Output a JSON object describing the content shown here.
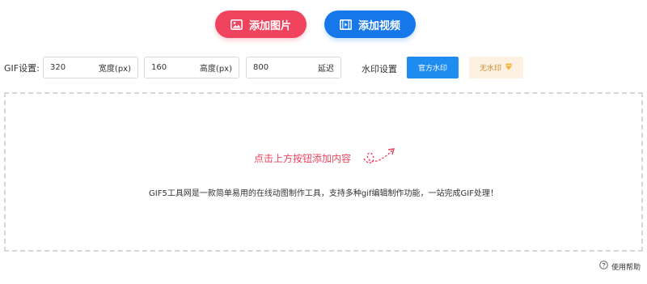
{
  "top_buttons": {
    "add_image": "添加图片",
    "add_video": "添加视频",
    "add_image_color": "#f0435d",
    "add_video_color": "#1677ea"
  },
  "settings": {
    "gif_label": "GIF设置:",
    "width": {
      "value": "320",
      "unit": "宽度(px)"
    },
    "height": {
      "value": "160",
      "unit": "高度(px)"
    },
    "delay": {
      "value": "800",
      "unit": "延迟"
    },
    "watermark_label": "水印设置",
    "watermark_official": "官方水印",
    "watermark_none": "无水印"
  },
  "drop_area": {
    "hint": "点击上方按钮添加内容",
    "description": "GIF5工具网是一款简单易用的在线动图制作工具，支持多种gif编辑制作功能，一站完成GIF处理！"
  },
  "footer": {
    "help": "使用帮助"
  }
}
